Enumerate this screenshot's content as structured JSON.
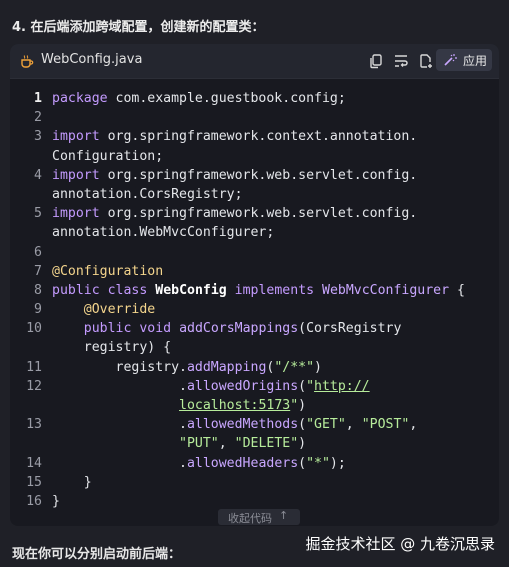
{
  "step_heading": "4. 在后端添加跨域配置，创建新的配置类：",
  "code_block": {
    "file_name": "WebConfig.java",
    "apply_label": "应用",
    "collapse_label": "收起代码",
    "collapse_arrow": "↑",
    "lines": [
      {
        "num": "1",
        "tokens": [
          {
            "t": "package",
            "c": "kw"
          },
          {
            "t": " com.example.guestbook.config;",
            "c": "plain"
          }
        ]
      },
      {
        "num": "2",
        "tokens": []
      },
      {
        "num": "3",
        "tokens": [
          {
            "t": "import",
            "c": "kw"
          },
          {
            "t": " org.springframework.context.annotation.",
            "c": "plain"
          }
        ]
      },
      {
        "num": "",
        "tokens": [
          {
            "t": "Configuration;",
            "c": "plain"
          }
        ]
      },
      {
        "num": "4",
        "tokens": [
          {
            "t": "import",
            "c": "kw"
          },
          {
            "t": " org.springframework.web.servlet.config.",
            "c": "plain"
          }
        ]
      },
      {
        "num": "",
        "tokens": [
          {
            "t": "annotation.CorsRegistry;",
            "c": "plain"
          }
        ]
      },
      {
        "num": "5",
        "tokens": [
          {
            "t": "import",
            "c": "kw"
          },
          {
            "t": " org.springframework.web.servlet.config.",
            "c": "plain"
          }
        ]
      },
      {
        "num": "",
        "tokens": [
          {
            "t": "annotation.WebMvcConfigurer;",
            "c": "plain"
          }
        ]
      },
      {
        "num": "6",
        "tokens": []
      },
      {
        "num": "7",
        "tokens": [
          {
            "t": "@Configuration",
            "c": "ann"
          }
        ]
      },
      {
        "num": "8",
        "tokens": [
          {
            "t": "public",
            "c": "kw"
          },
          {
            "t": " ",
            "c": "plain"
          },
          {
            "t": "class",
            "c": "kw"
          },
          {
            "t": " ",
            "c": "plain"
          },
          {
            "t": "WebConfig",
            "c": "cls"
          },
          {
            "t": " ",
            "c": "plain"
          },
          {
            "t": "implements",
            "c": "kw"
          },
          {
            "t": " ",
            "c": "plain"
          },
          {
            "t": "WebMvcConfigurer",
            "c": "fn"
          },
          {
            "t": " {",
            "c": "plain"
          }
        ]
      },
      {
        "num": "9",
        "tokens": [
          {
            "t": "    ",
            "c": "plain"
          },
          {
            "t": "@Override",
            "c": "ann"
          }
        ]
      },
      {
        "num": "10",
        "tokens": [
          {
            "t": "    ",
            "c": "plain"
          },
          {
            "t": "public",
            "c": "kw"
          },
          {
            "t": " ",
            "c": "plain"
          },
          {
            "t": "void",
            "c": "kw"
          },
          {
            "t": " ",
            "c": "plain"
          },
          {
            "t": "addCorsMappings",
            "c": "fn"
          },
          {
            "t": "(CorsRegistry",
            "c": "plain"
          }
        ]
      },
      {
        "num": "",
        "tokens": [
          {
            "t": "    registry) {",
            "c": "plain"
          }
        ]
      },
      {
        "num": "11",
        "tokens": [
          {
            "t": "        registry.",
            "c": "plain"
          },
          {
            "t": "addMapping",
            "c": "fn"
          },
          {
            "t": "(",
            "c": "plain"
          },
          {
            "t": "\"/**\"",
            "c": "str"
          },
          {
            "t": ")",
            "c": "plain"
          }
        ]
      },
      {
        "num": "12",
        "tokens": [
          {
            "t": "                .",
            "c": "plain"
          },
          {
            "t": "allowedOrigins",
            "c": "fn"
          },
          {
            "t": "(",
            "c": "plain"
          },
          {
            "t": "\"",
            "c": "str"
          },
          {
            "t": "http://",
            "c": "url"
          }
        ]
      },
      {
        "num": "",
        "tokens": [
          {
            "t": "                ",
            "c": "plain"
          },
          {
            "t": "localhost:5173",
            "c": "url"
          },
          {
            "t": "\"",
            "c": "str"
          },
          {
            "t": ")",
            "c": "plain"
          }
        ]
      },
      {
        "num": "13",
        "tokens": [
          {
            "t": "                .",
            "c": "plain"
          },
          {
            "t": "allowedMethods",
            "c": "fn"
          },
          {
            "t": "(",
            "c": "plain"
          },
          {
            "t": "\"GET\"",
            "c": "str"
          },
          {
            "t": ", ",
            "c": "plain"
          },
          {
            "t": "\"POST\"",
            "c": "str"
          },
          {
            "t": ",",
            "c": "plain"
          }
        ]
      },
      {
        "num": "",
        "tokens": [
          {
            "t": "                ",
            "c": "plain"
          },
          {
            "t": "\"PUT\"",
            "c": "str"
          },
          {
            "t": ", ",
            "c": "plain"
          },
          {
            "t": "\"DELETE\"",
            "c": "str"
          },
          {
            "t": ")",
            "c": "plain"
          }
        ]
      },
      {
        "num": "14",
        "tokens": [
          {
            "t": "                .",
            "c": "plain"
          },
          {
            "t": "allowedHeaders",
            "c": "fn"
          },
          {
            "t": "(",
            "c": "plain"
          },
          {
            "t": "\"*\"",
            "c": "str"
          },
          {
            "t": ");",
            "c": "plain"
          }
        ]
      },
      {
        "num": "15",
        "tokens": [
          {
            "t": "    }",
            "c": "plain"
          }
        ]
      },
      {
        "num": "16",
        "tokens": [
          {
            "t": "}",
            "c": "plain"
          }
        ]
      }
    ]
  },
  "bottom_text": "现在你可以分别启动前后端：",
  "watermark": "掘金技术社区 @ 九卷沉思录"
}
